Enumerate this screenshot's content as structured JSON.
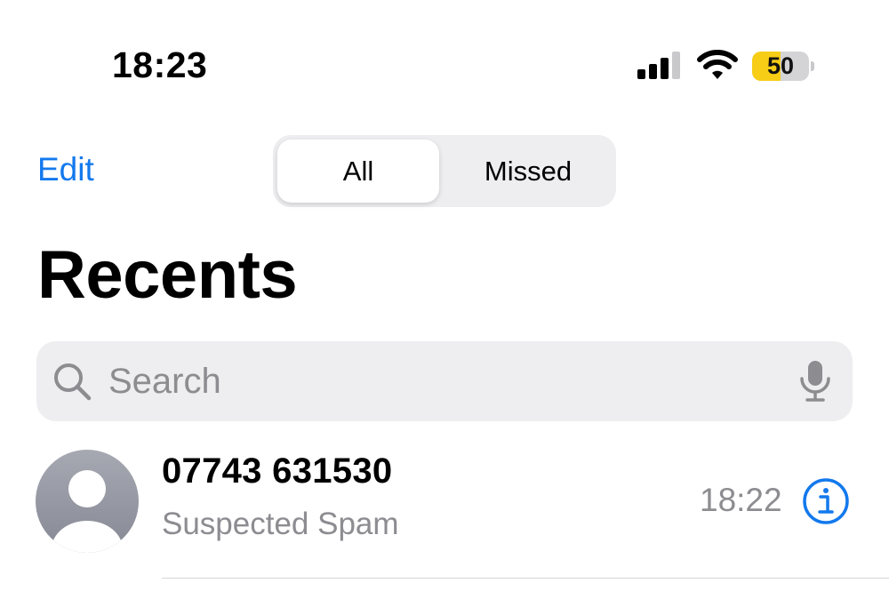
{
  "status_bar": {
    "time": "18:23",
    "battery_level": "50",
    "battery_fraction": 0.5,
    "signal_icon": "cellular-signal-icon",
    "wifi_icon": "wifi-icon",
    "battery_color": "#f7cd16"
  },
  "nav": {
    "edit_label": "Edit",
    "segments": [
      "All",
      "Missed"
    ],
    "selected_segment": "All"
  },
  "page_title": "Recents",
  "search": {
    "placeholder": "Search",
    "icon": "search-icon",
    "mic_icon": "microphone-icon"
  },
  "calls": [
    {
      "number": "07743 631530",
      "label": "Suspected Spam",
      "time": "18:22",
      "info_icon": "info-icon"
    }
  ],
  "colors": {
    "accent": "#1379ed",
    "secondary_text": "#8c8c91",
    "control_bg": "#eeeef0"
  }
}
